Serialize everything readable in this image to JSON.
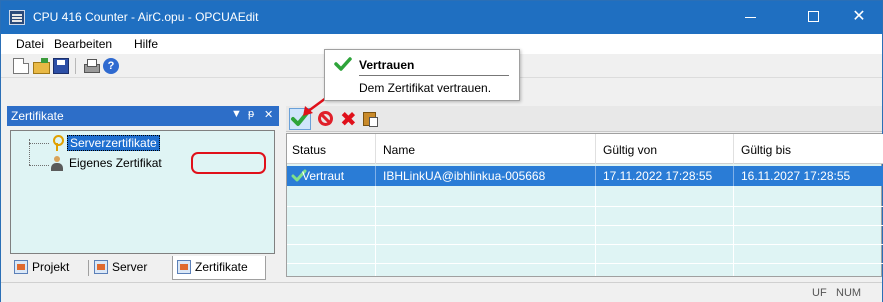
{
  "window": {
    "title": "CPU 416 Counter - AirC.opu - OPCUAEdit",
    "accent": "#1f6fc1"
  },
  "menu": {
    "items": [
      "Datei",
      "Bearbeiten",
      "Hilfe"
    ]
  },
  "toolbar": {
    "icons": [
      "new-icon",
      "open-icon",
      "save-icon",
      "print-icon",
      "help-icon"
    ]
  },
  "tooltip": {
    "title": "Vertrauen",
    "description": "Dem Zertifikat vertrauen."
  },
  "left_panel": {
    "title": "Zertifikate",
    "tree": [
      {
        "label": "Serverzertifikate",
        "selected": true
      },
      {
        "label": "Eigenes Zertifikat",
        "selected": false
      }
    ],
    "tabs": [
      "Projekt",
      "Server",
      "Zertifikate"
    ],
    "active_tab": "Zertifikate"
  },
  "cert_toolbar": {
    "icons": [
      "trust-icon",
      "revoke-icon",
      "delete-icon",
      "paste-icon"
    ]
  },
  "cert_list": {
    "columns": [
      "Status",
      "Name",
      "Gültig von",
      "Gültig bis"
    ],
    "rows": [
      {
        "status": "Vertraut",
        "name": "IBHLinkUA@ibhlinkua-005668",
        "valid_from": "17.11.2022 17:28:55",
        "valid_to": "16.11.2027 17:28:55"
      }
    ],
    "selection_color": "#2a7cd6"
  },
  "statusbar": {
    "indicators": [
      "UF",
      "NUM"
    ]
  },
  "highlight_color": "#e0101a"
}
